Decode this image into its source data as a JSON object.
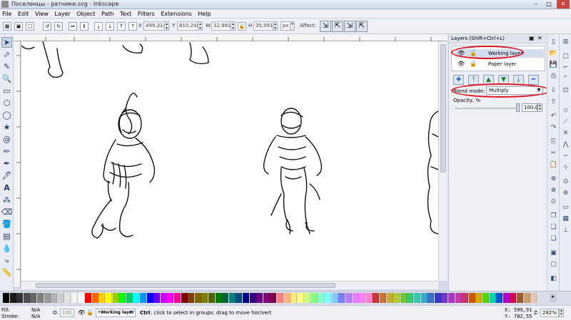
{
  "window": {
    "title": "Поселенцы - ратники.svg - Inkscape",
    "minimize": "–",
    "maximize": "□",
    "close": "✕"
  },
  "menu": [
    "File",
    "Edit",
    "View",
    "Layer",
    "Object",
    "Path",
    "Text",
    "Filters",
    "Extensions",
    "Help"
  ],
  "toolbar": {
    "x_label": "X",
    "x_value": "499,314",
    "y_label": "Y",
    "y_value": "810,248",
    "w_label": "W",
    "w_value": "32,981",
    "h_label": "H",
    "h_value": "35,991",
    "units": "px",
    "affect_label": "Affect:"
  },
  "layers_panel": {
    "title": "Layers (Shift+Ctrl+L)",
    "layers": [
      {
        "name": "Working layer",
        "visible": true,
        "locked": false
      },
      {
        "name": "Paper layer",
        "visible": true,
        "locked": true
      }
    ],
    "blend_label": "Blend mode:",
    "blend_value": "Multiply",
    "opacity_label": "Opacity, %",
    "opacity_value": "100,0"
  },
  "status": {
    "fill_label": "Fill:",
    "fill_value": "N/A",
    "stroke_label": "Stroke:",
    "stroke_value": "N/A",
    "o_label": "O:",
    "o_value": "100",
    "layer_select": "•Working layer",
    "message_key": "Ctrl",
    "message": ": click to select in groups; drag to move hor/vert",
    "x_label": "X:",
    "x_value": "599,91",
    "y_label": "Y:",
    "y_value": "782,55",
    "z_label": "Z:",
    "zoom": "282%"
  },
  "colors": {
    "highlight": "#e0141e",
    "palette": [
      "#000000",
      "#1a1a1a",
      "#333333",
      "#4d4d4d",
      "#666666",
      "#808080",
      "#999999",
      "#b3b3b3",
      "#cccccc",
      "#e6e6e6",
      "#f2f2f2",
      "#ffffff",
      "#ff0000",
      "#ff6600",
      "#ffcc00",
      "#ffff00",
      "#99cc00",
      "#00ff00",
      "#00cc66",
      "#00ffff",
      "#0099ff",
      "#0000ff",
      "#6600ff",
      "#cc00ff",
      "#ff00ff",
      "#ff0099",
      "#800000",
      "#804000",
      "#806600",
      "#808000",
      "#4d6600",
      "#008000",
      "#006633",
      "#008080",
      "#004d80",
      "#000080",
      "#330080",
      "#660080",
      "#800080",
      "#80004d",
      "#ff8080",
      "#ffb380",
      "#ffe680",
      "#ffff80",
      "#ccff80",
      "#80ff80",
      "#80ffcc",
      "#80ffff",
      "#80ccff",
      "#8080ff",
      "#b380ff",
      "#e680ff",
      "#ff80ff",
      "#ff80cc",
      "#c83737",
      "#c87137",
      "#c8ab37",
      "#b7c837",
      "#71c837",
      "#37c871",
      "#37c8ab",
      "#37abc8",
      "#3771c8",
      "#3737c8",
      "#7137c8",
      "#ab37c8",
      "#c837ab",
      "#c83771",
      "#d45500",
      "#d4aa00",
      "#55d400",
      "#00d4aa",
      "#0055d4",
      "#aa00d4",
      "#d40055",
      "#a05a2c",
      "#c8a06e",
      "#e9c6af"
    ]
  }
}
